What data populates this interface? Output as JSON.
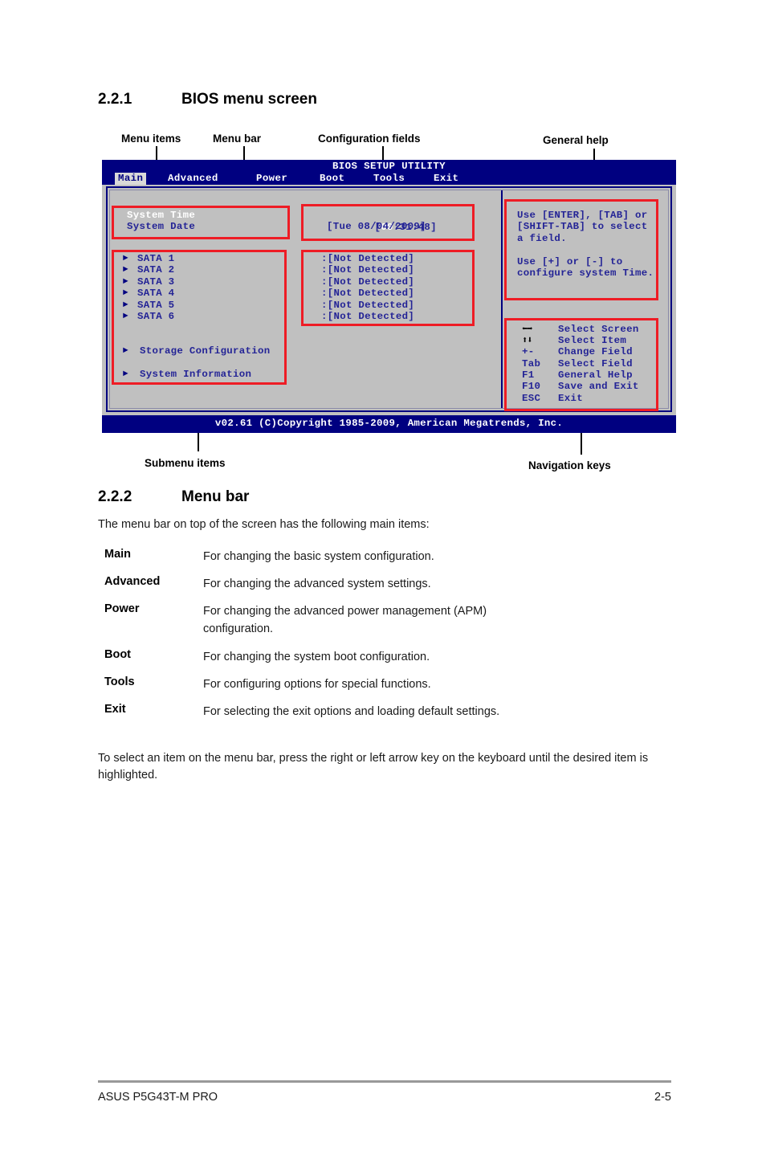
{
  "section_1": {
    "number": "2.2.1",
    "title": "BIOS menu screen"
  },
  "callouts": {
    "menu_items": "Menu items",
    "menu_bar": "Menu bar",
    "configuration_fields": "Configuration fields",
    "general_help": "General help",
    "submenu_items": "Submenu items",
    "navigation_keys": "Navigation keys"
  },
  "bios": {
    "title": "BIOS SETUP UTILITY",
    "menu_bar": [
      {
        "label": "Main",
        "active": true
      },
      {
        "label": "Advanced",
        "active": false
      },
      {
        "label": "Power",
        "active": false
      },
      {
        "label": "Boot",
        "active": false
      },
      {
        "label": "Tools",
        "active": false
      },
      {
        "label": "Exit",
        "active": false
      }
    ],
    "menu_items": [
      {
        "label": "System Time",
        "selected": true
      },
      {
        "label": "System Date",
        "selected": false
      }
    ],
    "config_fields": [
      {
        "value_prefix": "[",
        "value_selected": "00",
        "value_rest": ":31:48]"
      },
      {
        "value": "[Tue 08/04/2009]"
      }
    ],
    "device_items": [
      {
        "label": "SATA 1",
        "value": ":[Not Detected]"
      },
      {
        "label": "SATA 2",
        "value": ":[Not Detected]"
      },
      {
        "label": "SATA 3",
        "value": ":[Not Detected]"
      },
      {
        "label": "SATA 4",
        "value": ":[Not Detected]"
      },
      {
        "label": "SATA 5",
        "value": ":[Not Detected]"
      },
      {
        "label": "SATA 6",
        "value": ":[Not Detected]"
      }
    ],
    "submenu_items": [
      {
        "label": "Storage Configuration"
      },
      {
        "label": "System Information"
      }
    ],
    "general_help": [
      "Use [ENTER], [TAB] or",
      "[SHIFT-TAB] to select",
      "a field.",
      "",
      "Use [+] or [-] to",
      "configure system Time."
    ],
    "nav_keys": [
      {
        "key": "←→",
        "desc": "Select Screen"
      },
      {
        "key": "↑↓",
        "desc": "Select Item"
      },
      {
        "key": "+-",
        "desc": "Change Field"
      },
      {
        "key": "Tab",
        "desc": "Select Field"
      },
      {
        "key": "F1",
        "desc": "General Help"
      },
      {
        "key": "F10",
        "desc": "Save and Exit"
      },
      {
        "key": "ESC",
        "desc": "Exit"
      }
    ],
    "footer": "v02.61 (C)Copyright 1985-2009, American Megatrends, Inc."
  },
  "section_2": {
    "number": "2.2.2",
    "title": "Menu bar",
    "intro": "The menu bar on top of the screen has the following main items:",
    "entries": [
      {
        "term": "Main",
        "definition": "For changing the basic system configuration."
      },
      {
        "term": "Advanced",
        "definition": "For changing the advanced system settings."
      },
      {
        "term": "Power",
        "definition": "For changing the advanced power management (APM) configuration."
      },
      {
        "term": "Boot",
        "definition": "For changing the system boot configuration."
      },
      {
        "term": "Tools",
        "definition": "For configuring options for special functions."
      },
      {
        "term": "Exit",
        "definition": "For selecting the exit options and loading default settings."
      }
    ],
    "outro": "To select an item on the menu bar, press the right or left arrow key on the keyboard until the desired item is highlighted."
  },
  "page_footer": {
    "left": "ASUS P5G43T-M PRO",
    "right": "2-5"
  },
  "colors": {
    "bios_blue": "#000080",
    "bios_gray": "#c0c0c0",
    "annotation_red": "#ee1c25",
    "bios_text_blue": "#242496"
  }
}
